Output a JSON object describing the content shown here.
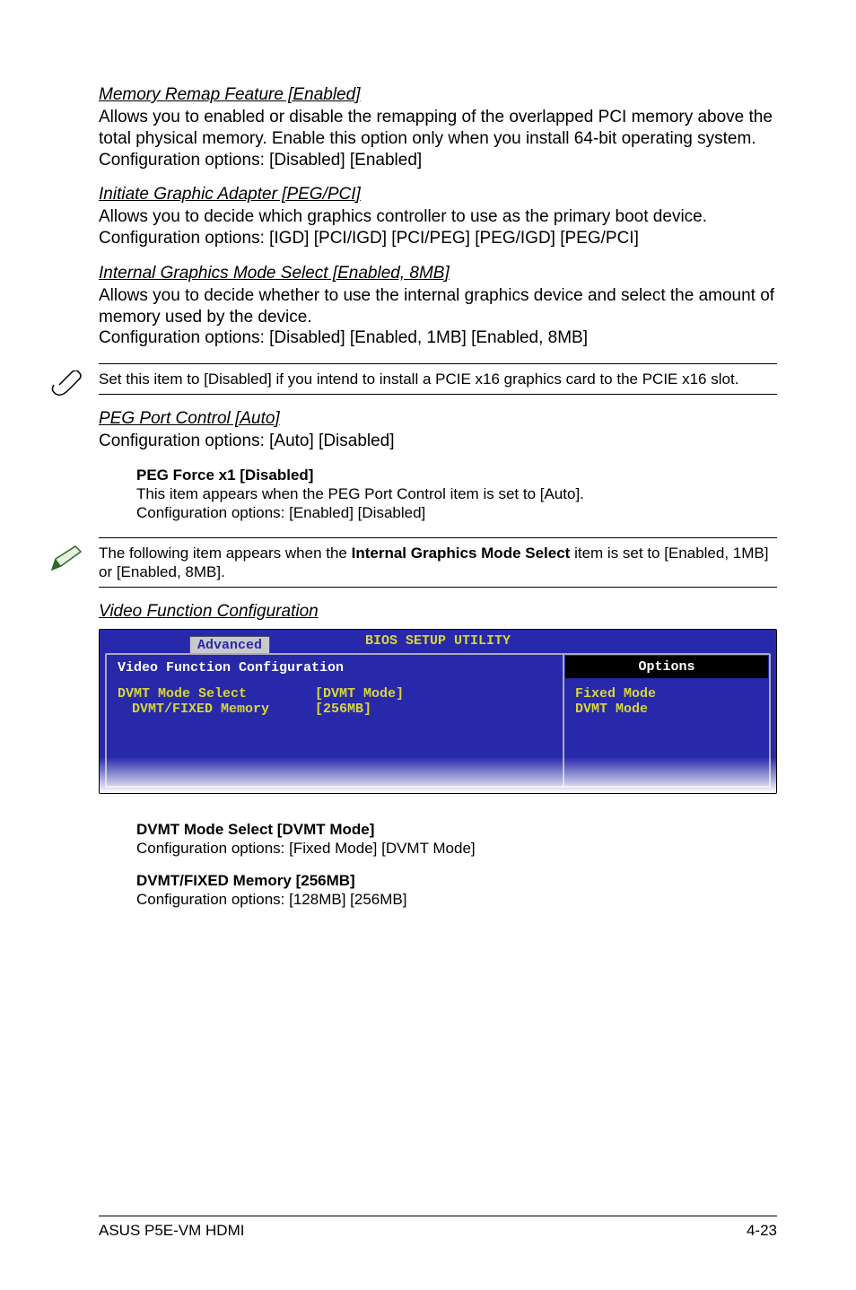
{
  "sec1": {
    "title": "Memory Remap Feature [Enabled]",
    "body": "Allows you to enabled or disable the remapping of the overlapped PCI memory above the total physical memory. Enable this option only when you install 64-bit operating system. Configuration options: [Disabled] [Enabled]"
  },
  "sec2": {
    "title": "Initiate Graphic Adapter [PEG/PCI]",
    "body": "Allows you to decide which graphics controller to use as the primary boot device. Configuration options: [IGD] [PCI/IGD] [PCI/PEG] [PEG/IGD] [PEG/PCI]"
  },
  "sec3": {
    "title": "Internal Graphics Mode Select [Enabled, 8MB]",
    "body1": "Allows you to decide whether to use the internal graphics device and select the amount of memory used by the device.",
    "body2": "Configuration options: [Disabled] [Enabled, 1MB] [Enabled, 8MB]"
  },
  "note1": "Set this item to [Disabled] if you intend to install a PCIE x16 graphics card to the PCIE x16 slot.",
  "sec4": {
    "title": "PEG Port Control [Auto]",
    "body": "Configuration options: [Auto] [Disabled]"
  },
  "sub1": {
    "heading": "PEG Force x1 [Disabled]",
    "line1": "This item appears when the PEG Port Control item is set to [Auto].",
    "line2": "Configuration options: [Enabled] [Disabled]"
  },
  "note2_pre": "The following item appears when the ",
  "note2_bold": "Internal Graphics Mode Select",
  "note2_post": " item is set to [Enabled, 1MB] or [Enabled, 8MB].",
  "sec5": {
    "title": "Video Function Configuration"
  },
  "bios": {
    "utility_title": "BIOS SETUP UTILITY",
    "tab": "Advanced",
    "config_title": "Video Function Configuration",
    "row1_k": "DVMT Mode Select",
    "row1_v": "[DVMT Mode]",
    "row2_k": "DVMT/FIXED Memory",
    "row2_v": "[256MB]",
    "options_head": "Options",
    "opt1": "Fixed Mode",
    "opt2": "DVMT Mode"
  },
  "sub2": {
    "heading": "DVMT Mode Select [DVMT Mode]",
    "line": "Configuration options: [Fixed Mode] [DVMT Mode]"
  },
  "sub3": {
    "heading": "DVMT/FIXED Memory [256MB]",
    "line": "Configuration options: [128MB] [256MB]"
  },
  "footer": {
    "left": "ASUS P5E-VM HDMI",
    "right": "4-23"
  }
}
